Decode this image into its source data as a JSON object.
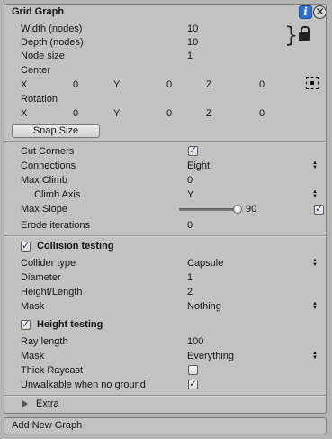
{
  "header": {
    "title": "Grid Graph",
    "info_icon": "i",
    "close_icon": "✕"
  },
  "grid": {
    "width_label": "Width (nodes)",
    "width_value": "10",
    "depth_label": "Depth (nodes)",
    "depth_value": "10",
    "node_size_label": "Node size",
    "node_size_value": "1",
    "center_label": "Center",
    "center": {
      "x_label": "X",
      "x": "0",
      "y_label": "Y",
      "y": "0",
      "z_label": "Z",
      "z": "0"
    },
    "rotation_label": "Rotation",
    "rotation": {
      "x_label": "X",
      "x": "0",
      "y_label": "Y",
      "y": "0",
      "z_label": "Z",
      "z": "0"
    },
    "snap_size_button": "Snap Size"
  },
  "settings": {
    "cut_corners_label": "Cut Corners",
    "cut_corners_checked": true,
    "connections_label": "Connections",
    "connections_value": "Eight",
    "max_climb_label": "Max Climb",
    "max_climb_value": "0",
    "climb_axis_label": "Climb Axis",
    "climb_axis_value": "Y",
    "max_slope_label": "Max Slope",
    "max_slope_value": "90",
    "max_slope_fraction": 1.0,
    "max_slope_checked": true,
    "erode_label": "Erode iterations",
    "erode_value": "0"
  },
  "collision": {
    "header": "Collision testing",
    "checked": true,
    "collider_type_label": "Collider type",
    "collider_type_value": "Capsule",
    "diameter_label": "Diameter",
    "diameter_value": "1",
    "height_length_label": "Height/Length",
    "height_length_value": "2",
    "mask_label": "Mask",
    "mask_value": "Nothing"
  },
  "height": {
    "header": "Height testing",
    "checked": true,
    "ray_length_label": "Ray length",
    "ray_length_value": "100",
    "mask_label": "Mask",
    "mask_value": "Everything",
    "thick_raycast_label": "Thick Raycast",
    "thick_raycast_checked": false,
    "unwalkable_label": "Unwalkable when no ground",
    "unwalkable_checked": true
  },
  "extra_label": "Extra",
  "add_new_graph": "Add New Graph",
  "colors": {
    "panel_bg": "#c2c2c2",
    "window_bg": "#b4b4b4",
    "info_blue": "#2f6fd0"
  }
}
